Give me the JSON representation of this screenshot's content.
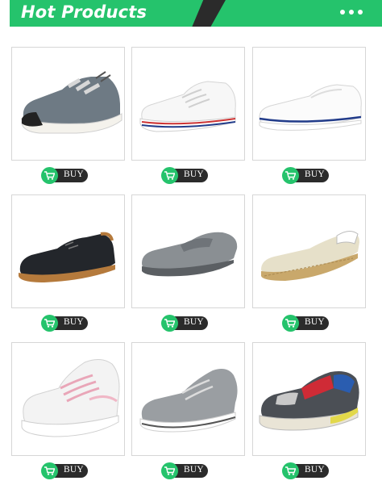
{
  "header": {
    "title": "Hot Products",
    "colors": {
      "green": "#25c36c",
      "dark": "#2b2b2b"
    },
    "menu_icon": "more-dots-icon"
  },
  "buy_icon": "shopping-cart-icon",
  "products": [
    {
      "name": "grey-canvas-sneaker",
      "buy_label": "BUY"
    },
    {
      "name": "white-lace-up-canvas-sneaker",
      "buy_label": "BUY"
    },
    {
      "name": "white-slip-on-canvas-shoe",
      "buy_label": "BUY"
    },
    {
      "name": "black-suede-oxford-shoe",
      "buy_label": "BUY"
    },
    {
      "name": "grey-suede-loafer",
      "buy_label": "BUY"
    },
    {
      "name": "cream-espadrille",
      "buy_label": "BUY"
    },
    {
      "name": "white-pink-chunky-sneaker",
      "buy_label": "BUY"
    },
    {
      "name": "grey-mesh-running-shoe",
      "buy_label": "BUY"
    },
    {
      "name": "multicolor-chunky-sneaker",
      "buy_label": "BUY"
    }
  ]
}
